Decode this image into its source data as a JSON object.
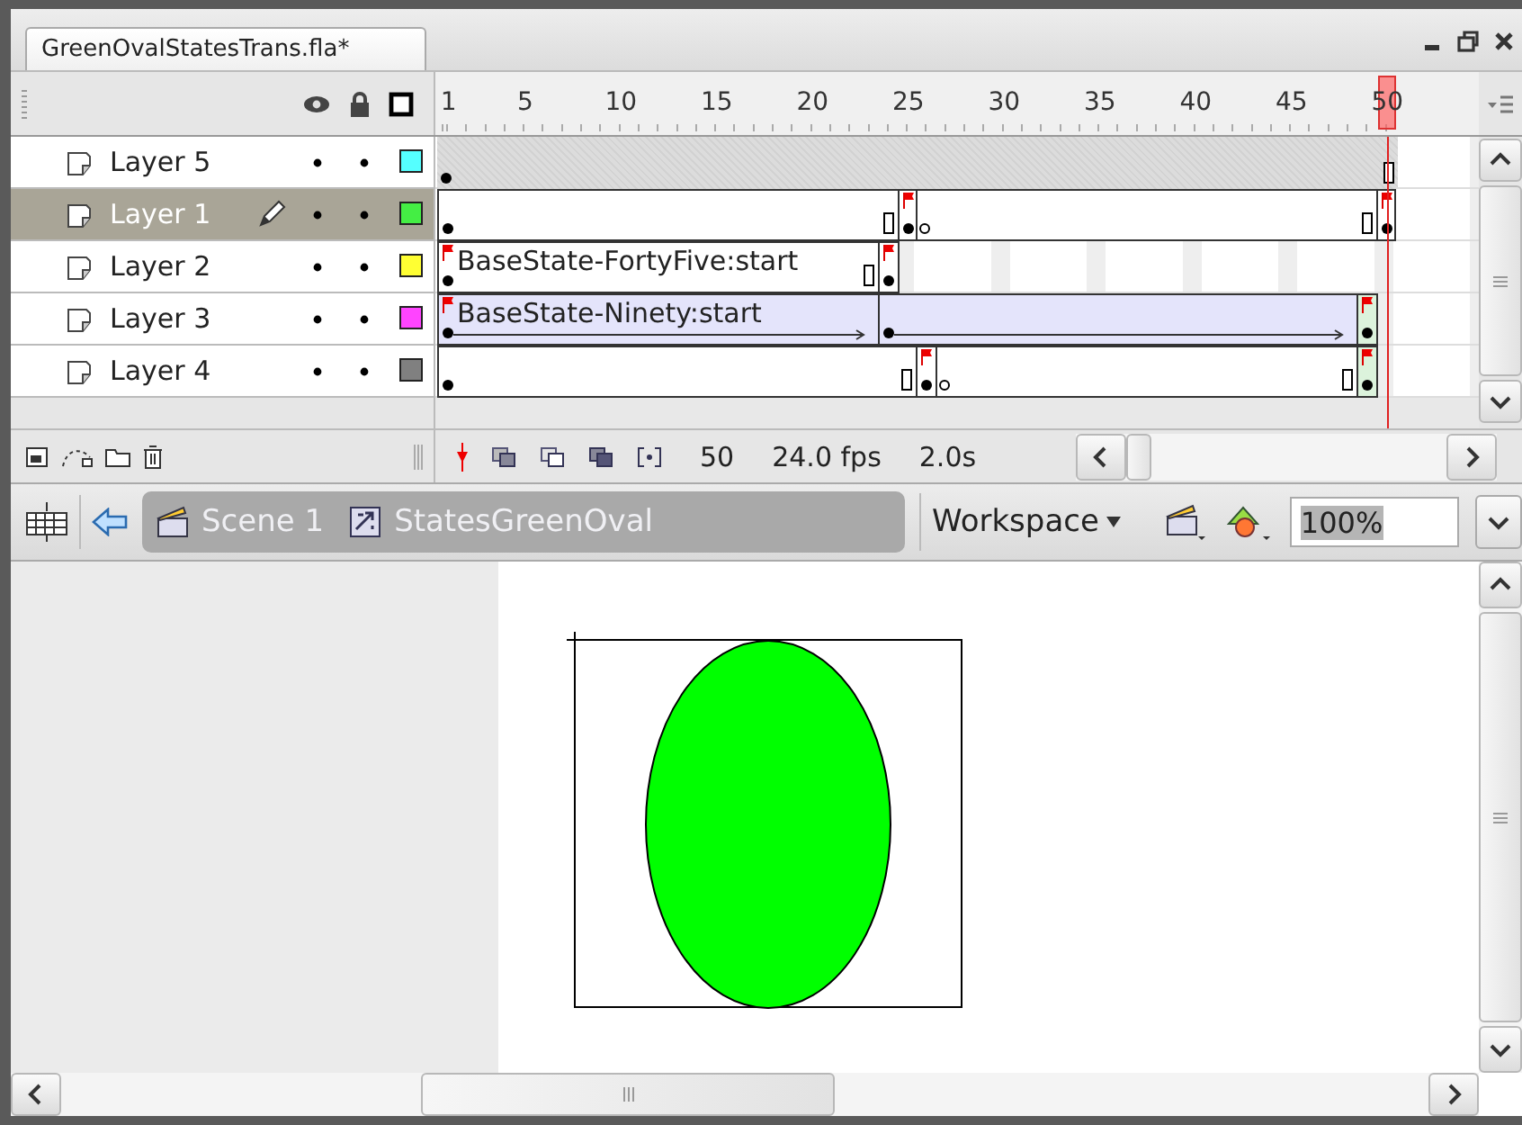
{
  "document_tab": {
    "title": "GreenOvalStatesTrans.fla*",
    "selected": true
  },
  "timeline": {
    "ruler": [
      "1",
      "5",
      "10",
      "15",
      "20",
      "25",
      "30",
      "35",
      "40",
      "45",
      "50"
    ],
    "layers": [
      {
        "name": "Layer 5",
        "selected": false,
        "editing": false,
        "visible": true,
        "locked": false,
        "color": "#55ffff",
        "spans": [
          {
            "kind": "blank",
            "flag": false
          }
        ]
      },
      {
        "name": "Layer 1",
        "selected": true,
        "editing": true,
        "visible": true,
        "locked": false,
        "color": "#44ee44",
        "spans": [
          {
            "kind": "static",
            "flag": false
          },
          {
            "kind": "static",
            "flag": true
          },
          {
            "kind": "static",
            "flag": false
          },
          {
            "kind": "static",
            "flag": true
          }
        ]
      },
      {
        "name": "Layer 2",
        "selected": false,
        "editing": false,
        "visible": true,
        "locked": false,
        "color": "#ffff33",
        "spans": [
          {
            "kind": "static",
            "flag": true,
            "label": "BaseState-FortyFive:start"
          },
          {
            "kind": "static",
            "flag": true
          }
        ]
      },
      {
        "name": "Layer 3",
        "selected": false,
        "editing": false,
        "visible": true,
        "locked": false,
        "color": "#ff44ff",
        "spans": [
          {
            "kind": "tween",
            "flag": true,
            "label": "BaseState-Ninety:start"
          },
          {
            "kind": "tween",
            "flag": false
          },
          {
            "kind": "key",
            "flag": true
          }
        ]
      },
      {
        "name": "Layer 4",
        "selected": false,
        "editing": false,
        "visible": true,
        "locked": false,
        "color": "#808080",
        "spans": [
          {
            "kind": "static",
            "flag": false
          },
          {
            "kind": "static",
            "flag": true
          },
          {
            "kind": "static",
            "flag": false
          },
          {
            "kind": "key",
            "flag": true
          }
        ]
      }
    ],
    "status": {
      "frame": "50",
      "fps": "24.0 fps",
      "time": "2.0s"
    }
  },
  "breadcrumb": [
    {
      "kind": "scene",
      "label": "Scene 1"
    },
    {
      "kind": "symbol",
      "label": "StatesGreenOval"
    }
  ],
  "workspace": {
    "label": "Workspace"
  },
  "zoom": {
    "value": "100%"
  },
  "stage": {
    "shape": {
      "kind": "oval",
      "color": "#00ff00"
    }
  }
}
